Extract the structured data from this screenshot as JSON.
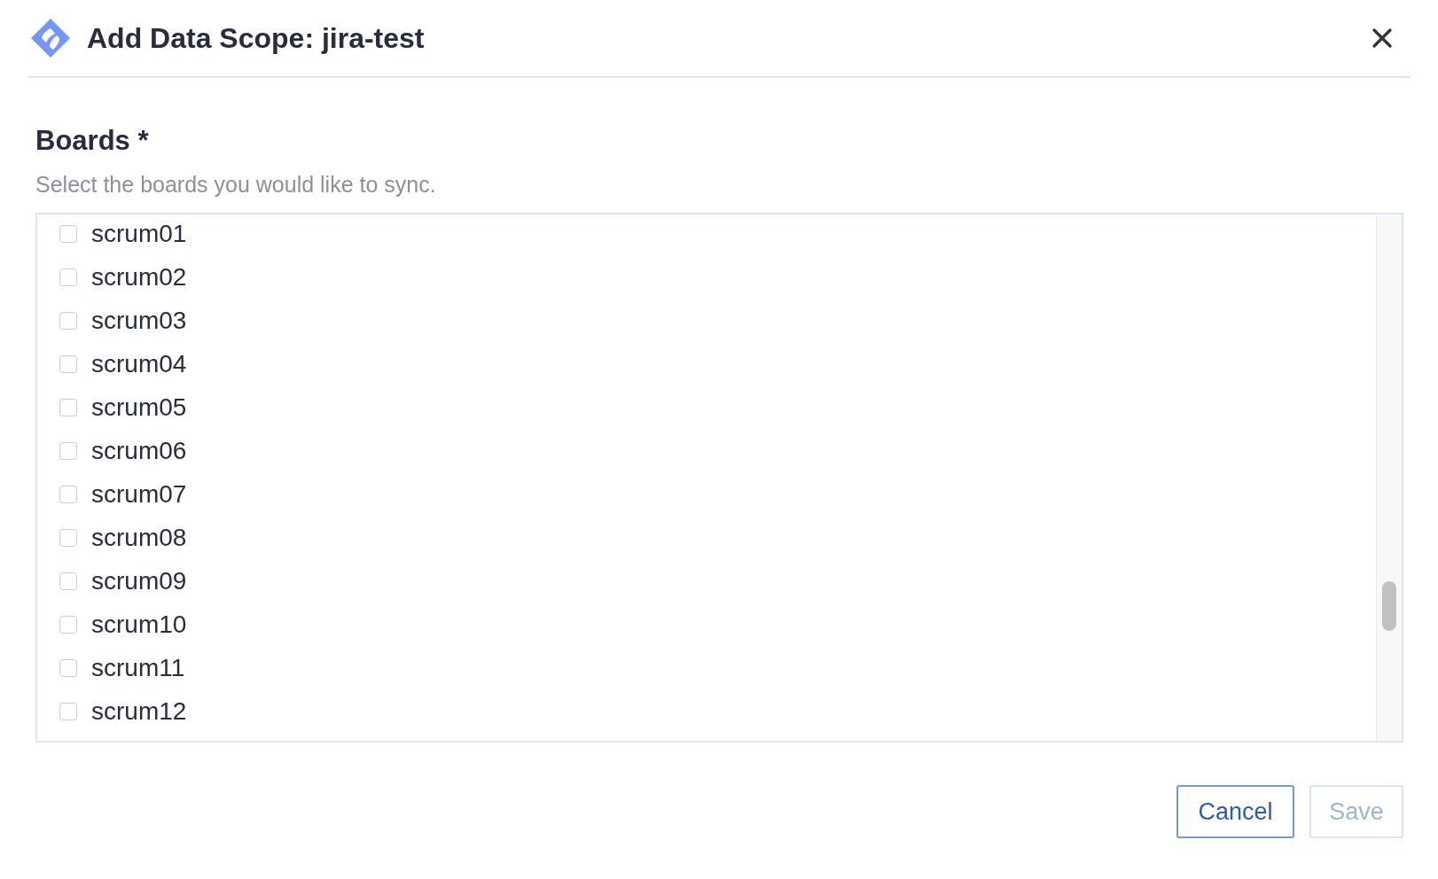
{
  "dialog": {
    "title": "Add Data Scope: jira-test"
  },
  "field": {
    "label": "Boards *",
    "help": "Select the boards you would like to sync."
  },
  "boards": [
    {
      "name": "scrum01",
      "checked": false
    },
    {
      "name": "scrum02",
      "checked": false
    },
    {
      "name": "scrum03",
      "checked": false
    },
    {
      "name": "scrum04",
      "checked": false
    },
    {
      "name": "scrum05",
      "checked": false
    },
    {
      "name": "scrum06",
      "checked": false
    },
    {
      "name": "scrum07",
      "checked": false
    },
    {
      "name": "scrum08",
      "checked": false
    },
    {
      "name": "scrum09",
      "checked": false
    },
    {
      "name": "scrum10",
      "checked": false
    },
    {
      "name": "scrum11",
      "checked": false
    },
    {
      "name": "scrum12",
      "checked": false
    }
  ],
  "buttons": [
    {
      "label": "Cancel",
      "kind": "secondary",
      "disabled": false
    },
    {
      "label": "Save",
      "kind": "primary",
      "disabled": true
    }
  ]
}
